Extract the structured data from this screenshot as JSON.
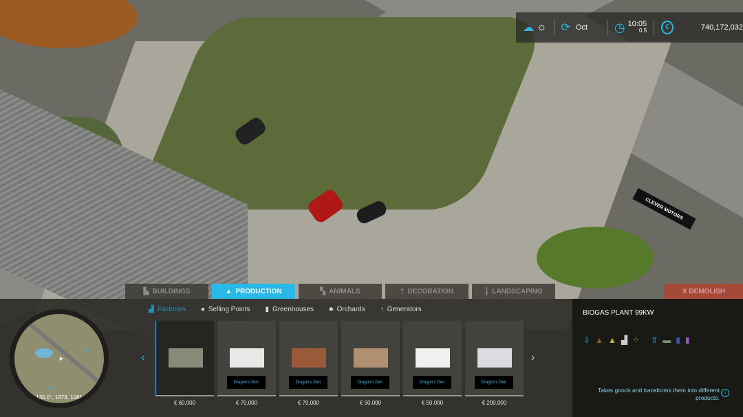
{
  "hud": {
    "weather_icons": [
      "cloud-icon",
      "sun-icon"
    ],
    "month": "Oct",
    "time": "10:05",
    "time_scale": "0.5",
    "currency_icon": "euro-icon",
    "money": "740,172,032"
  },
  "tabs": [
    {
      "label": "BUILDINGS",
      "icon": "building-icon",
      "active": false
    },
    {
      "label": "PRODUCTION",
      "icon": "factory-icon",
      "active": true
    },
    {
      "label": "ANIMALS",
      "icon": "cow-icon",
      "active": false
    },
    {
      "label": "DECORATION",
      "icon": "statue-icon",
      "active": false
    },
    {
      "label": "LANDSCAPING",
      "icon": "shovel-icon",
      "active": false
    }
  ],
  "demolish": "X DEMOLISH",
  "subtabs": [
    {
      "label": "Factories",
      "active": true
    },
    {
      "label": "Selling Points"
    },
    {
      "label": "Greenhouses"
    },
    {
      "label": "Orchards"
    },
    {
      "label": "Generators"
    }
  ],
  "minimap": {
    "coords": "135.0°, 1873, 1081",
    "labels": [
      "55",
      "34"
    ]
  },
  "items": [
    {
      "price": "€ 60,000",
      "brand": ""
    },
    {
      "price": "€ 70,000",
      "brand": "Dragon's Den"
    },
    {
      "price": "€ 70,000",
      "brand": "Dragon's Den"
    },
    {
      "price": "€ 50,000",
      "brand": "Dragon's Den"
    },
    {
      "price": "€ 50,000",
      "brand": "Dragon's Den"
    },
    {
      "price": "€ 200,000",
      "brand": "Dragon's Den"
    }
  ],
  "detail": {
    "title": "BIOGAS PLANT 99KW",
    "inputs": [
      "input-icon",
      "manure-icon",
      "slurry-icon",
      "silage-icon",
      "potatoes-icon"
    ],
    "outputs": [
      "output-icon",
      "digestate-icon",
      "methane-icon",
      "electricity-icon"
    ],
    "description": "Takes goods and transforms them into different products."
  },
  "scene": {
    "sign": "CLEVER MOTORS"
  },
  "colors": {
    "accent": "#28b9e8",
    "demolish": "#be3c28"
  }
}
